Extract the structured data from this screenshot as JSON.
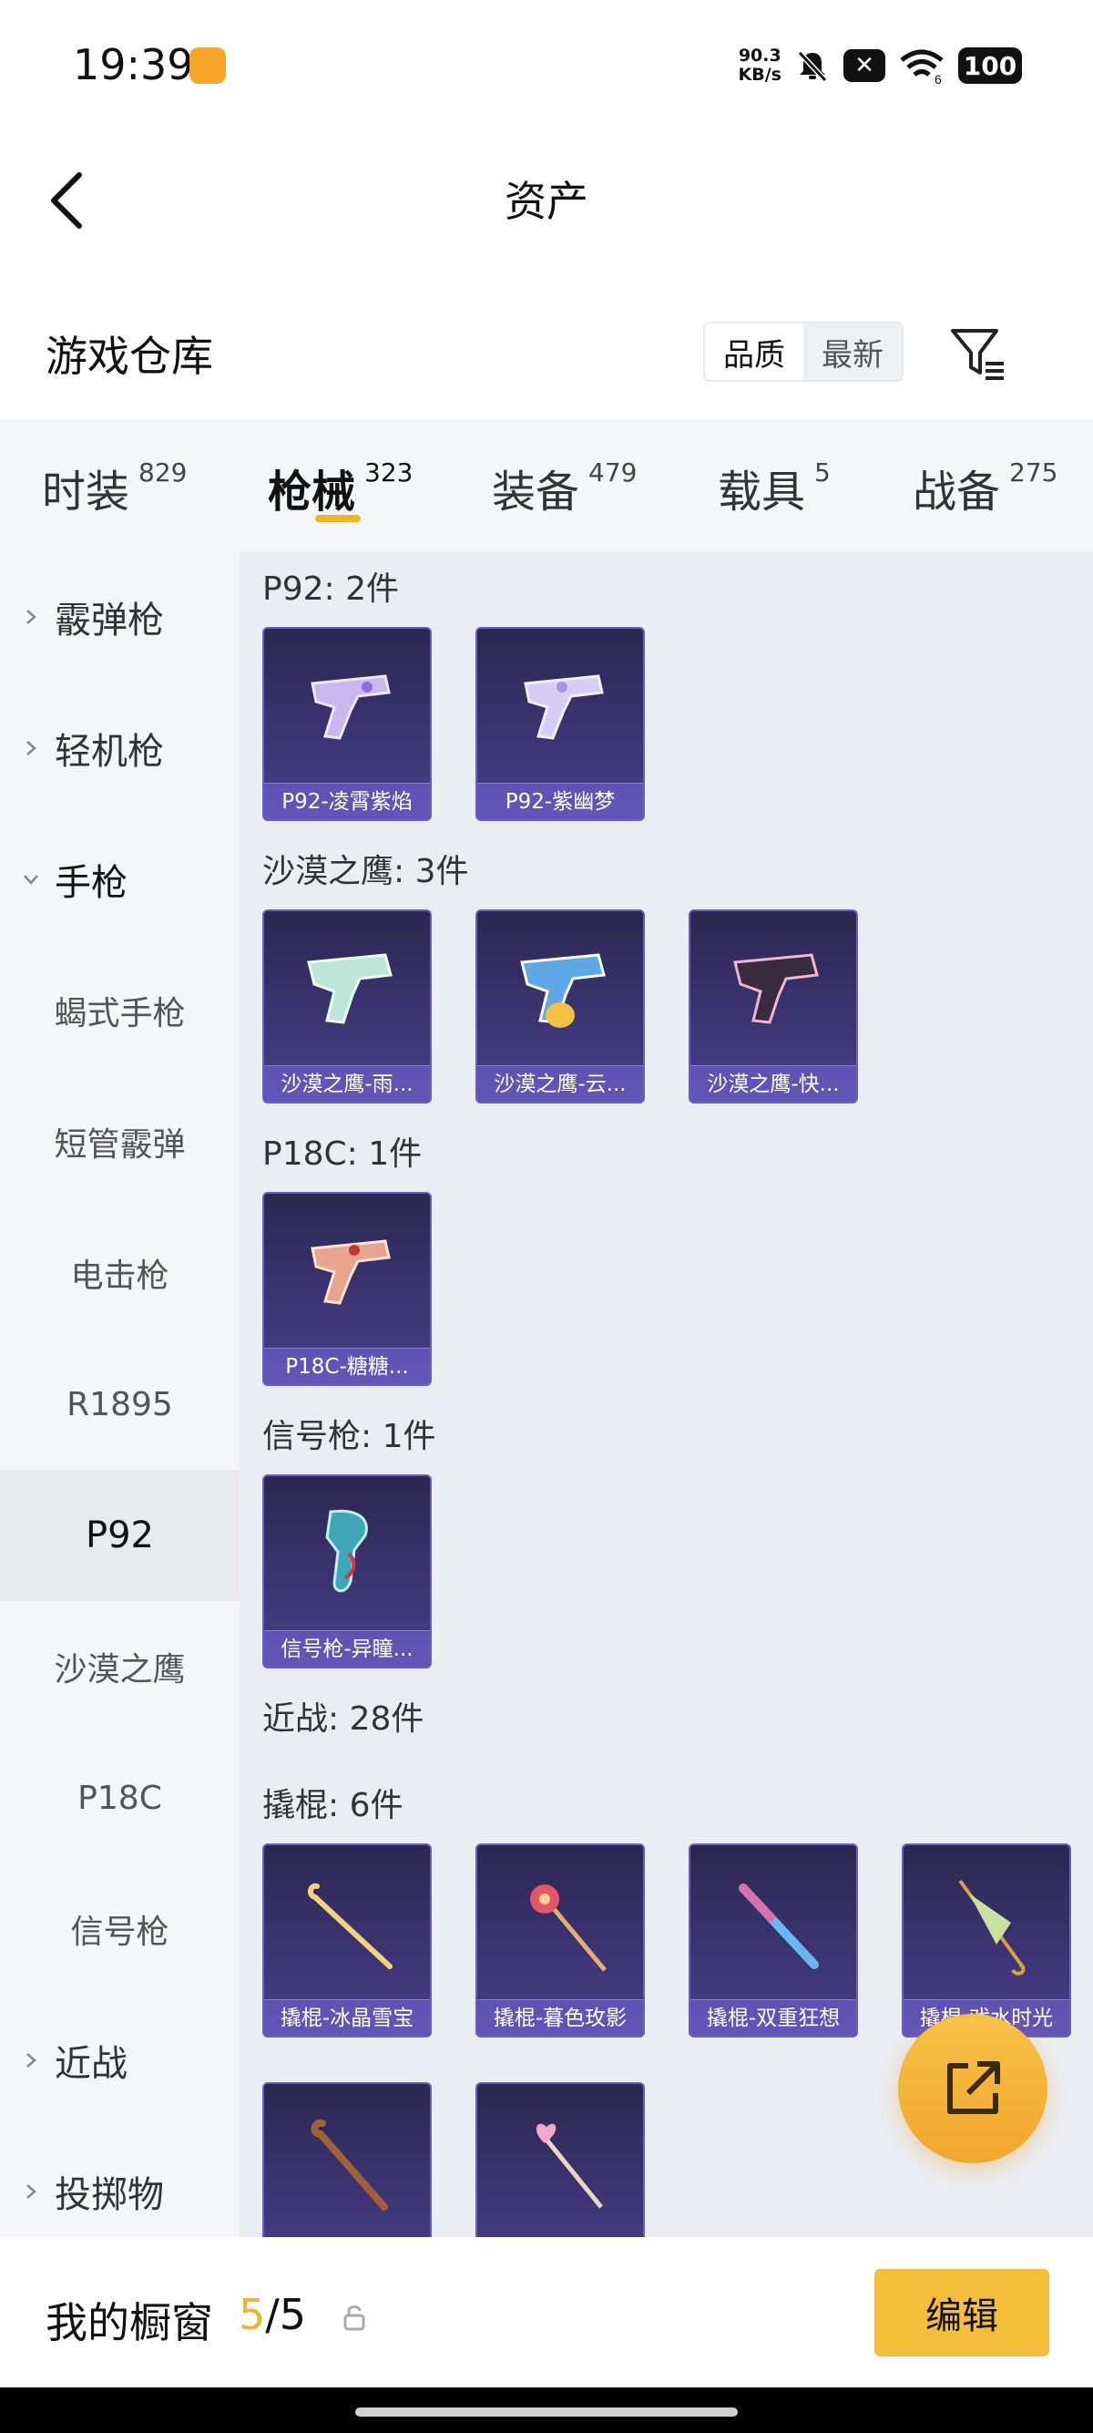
{
  "status_bar": {
    "time": "19:39",
    "net_speed_value": "90.3",
    "net_speed_unit": "KB/s",
    "battery": "100",
    "wifi_badge": "6",
    "icons": [
      "app-notification-icon",
      "mute-bell-icon",
      "close-badge-icon",
      "wifi-icon",
      "battery-icon"
    ]
  },
  "header": {
    "title": "资产"
  },
  "warehouse": {
    "title": "游戏仓库",
    "sort_options": [
      "品质",
      "最新"
    ],
    "sort_selected": "品质"
  },
  "tabs": [
    {
      "label": "时装",
      "count": "829"
    },
    {
      "label": "枪械",
      "count": "323",
      "active": true
    },
    {
      "label": "装备",
      "count": "479"
    },
    {
      "label": "载具",
      "count": "5"
    },
    {
      "label": "战备",
      "count": "275"
    }
  ],
  "sidebar": {
    "items": [
      {
        "label": "霰弹枪",
        "type": "group",
        "expanded": false
      },
      {
        "label": "轻机枪",
        "type": "group",
        "expanded": false
      },
      {
        "label": "手枪",
        "type": "group",
        "expanded": true
      },
      {
        "label": "蝎式手枪",
        "type": "sub"
      },
      {
        "label": "短管霰弹",
        "type": "sub"
      },
      {
        "label": "电击枪",
        "type": "sub"
      },
      {
        "label": "R1895",
        "type": "sub"
      },
      {
        "label": "P92",
        "type": "sub",
        "selected": true
      },
      {
        "label": "沙漠之鹰",
        "type": "sub"
      },
      {
        "label": "P18C",
        "type": "sub"
      },
      {
        "label": "信号枪",
        "type": "sub"
      },
      {
        "label": "近战",
        "type": "group",
        "expanded": false
      },
      {
        "label": "投掷物",
        "type": "group",
        "expanded": false
      }
    ]
  },
  "content": {
    "groups": [
      {
        "title": "P92: 2件",
        "items": [
          "P92-凌霄紫焰",
          "P92-紫幽梦"
        ]
      },
      {
        "title": "沙漠之鹰: 3件",
        "items": [
          "沙漠之鹰-雨...",
          "沙漠之鹰-云...",
          "沙漠之鹰-快..."
        ]
      },
      {
        "title": "P18C: 1件",
        "items": [
          "P18C-糖糖..."
        ]
      },
      {
        "title": "信号枪: 1件",
        "items": [
          "信号枪-异瞳..."
        ]
      },
      {
        "title": "近战: 28件",
        "items": []
      },
      {
        "title": "撬棍: 6件",
        "items": [
          "撬棍-冰晶雪宝",
          "撬棍-暮色玫影",
          "撬棍-双重狂想",
          "撬棍-戏水时光",
          "",
          ""
        ]
      }
    ]
  },
  "bottom_bar": {
    "title": "我的橱窗",
    "current": "5",
    "separator": "/",
    "total": "5",
    "edit_label": "编辑"
  },
  "colors": {
    "accent": "#f4bd3a",
    "card_bg": "#3d3575",
    "card_label_bg": "#7866dc",
    "sidebar_bg": "#f5f6f8",
    "content_bg": "#eaedf1"
  }
}
